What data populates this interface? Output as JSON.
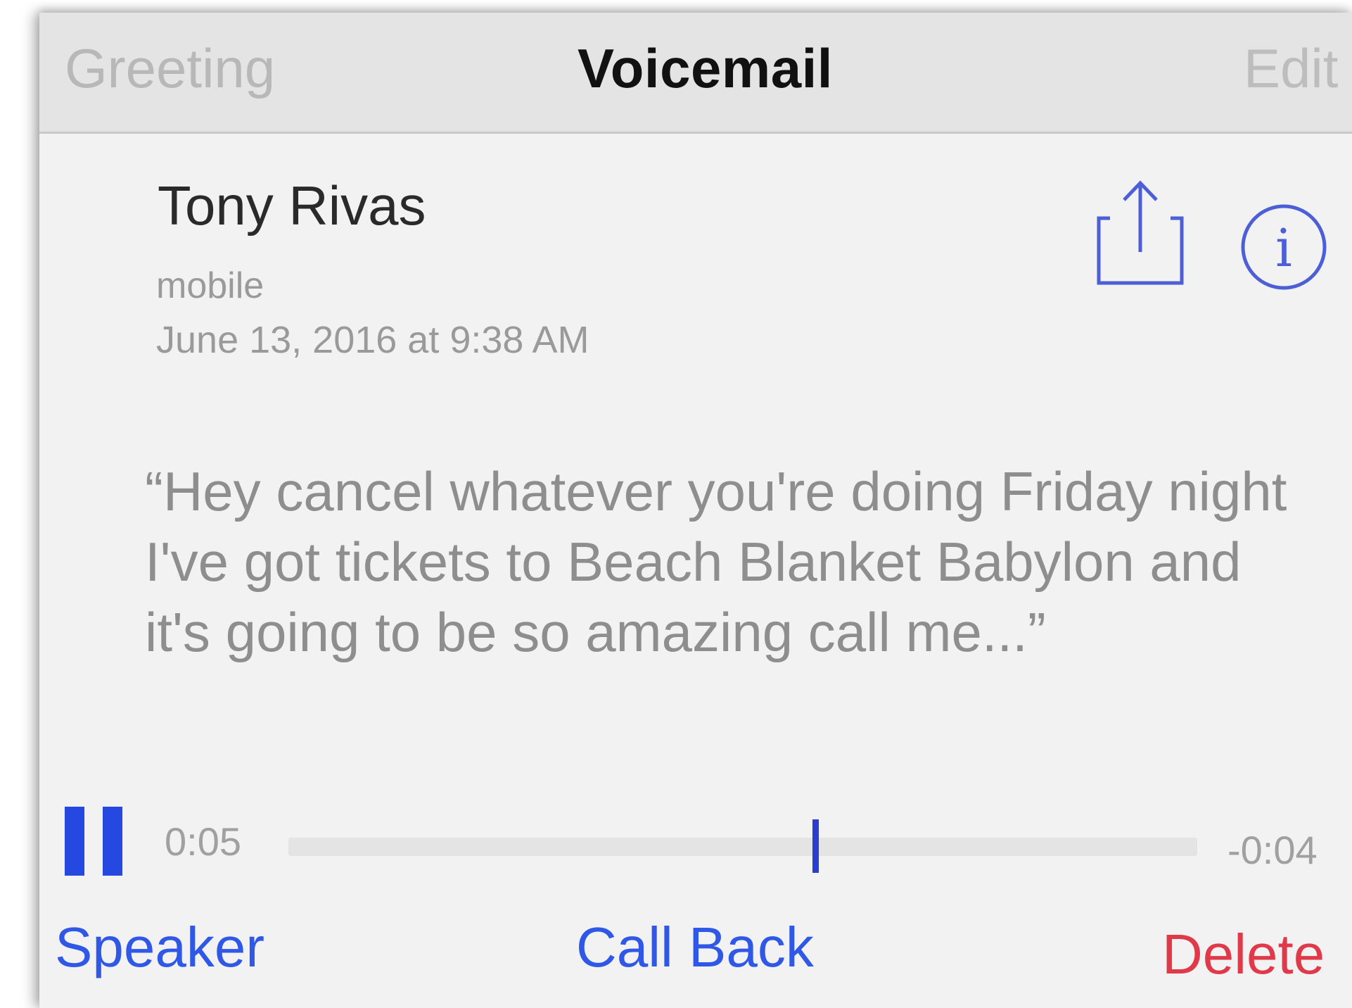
{
  "nav": {
    "left": "Greeting",
    "title": "Voicemail",
    "right": "Edit"
  },
  "voicemail": {
    "name": "Tony Rivas",
    "type": "mobile",
    "date": "June 13, 2016 at 9:38 AM",
    "transcript": "“Hey cancel whatever you're doing Friday night I've got tickets to Beach Blanket Babylon and it's going to be so amazing call me...”"
  },
  "player": {
    "elapsed": "0:05",
    "remaining": "-0:04",
    "progress": 0.58
  },
  "actions": {
    "speaker": "Speaker",
    "call_back": "Call Back",
    "delete": "Delete"
  },
  "icons": {
    "pause": "pause-icon",
    "share": "share-icon",
    "info": "info-icon"
  },
  "colors": {
    "accent": "#2f58e6",
    "destructive": "#e03a4a"
  }
}
